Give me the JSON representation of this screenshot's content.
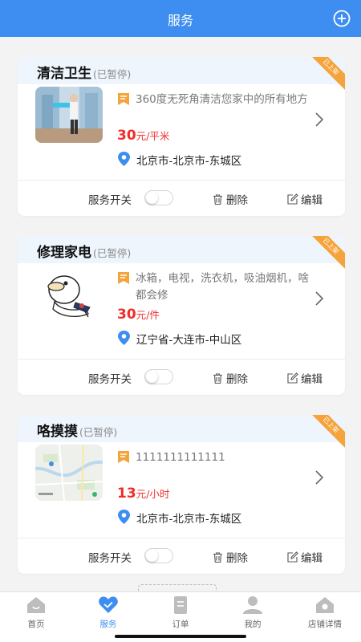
{
  "header": {
    "title": "服务"
  },
  "services": [
    {
      "name": "清洁卫生",
      "status": "(已暂停)",
      "ribbon": "已上架",
      "description": "360度无死角清洁您家中的所有地方",
      "price": "30",
      "price_currency": "元",
      "price_unit": "/平米",
      "location": "北京市-北京市-东城区"
    },
    {
      "name": "修理家电",
      "status": "(已暂停)",
      "ribbon": "已上架",
      "description": "冰箱，电视，洗衣机，吸油烟机，啥都会修",
      "price": "30",
      "price_currency": "元",
      "price_unit": "/件",
      "location": "辽宁省-大连市-中山区"
    },
    {
      "name": "咯摸摸",
      "status": "(已暂停)",
      "ribbon": "已上架",
      "description": "1111111111111",
      "price": "13",
      "price_currency": "元",
      "price_unit": "/小时",
      "location": "北京市-北京市-东城区"
    }
  ],
  "card_actions": {
    "switch_label": "服务开关",
    "delete_label": "删除",
    "edit_label": "编辑"
  },
  "tabbar": [
    {
      "label": "首页",
      "icon": "home-icon"
    },
    {
      "label": "服务",
      "icon": "heart-icon",
      "active": true
    },
    {
      "label": "订单",
      "icon": "order-icon"
    },
    {
      "label": "我的",
      "icon": "profile-icon"
    },
    {
      "label": "店铺详情",
      "icon": "store-icon"
    }
  ],
  "colors": {
    "primary": "#3d8ef0",
    "price": "#f02b2b",
    "ribbon": "#f5a33b",
    "desc_icon": "#f5a33b",
    "card_head": "#eef5fd"
  }
}
